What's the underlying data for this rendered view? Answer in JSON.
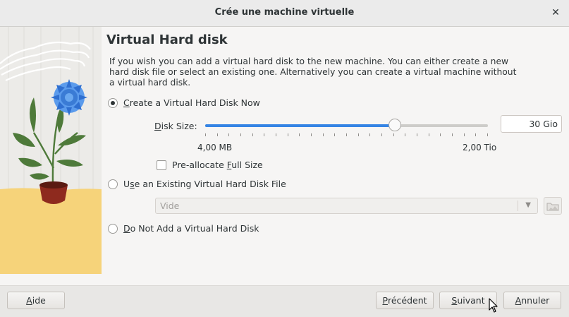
{
  "window": {
    "title": "Crée une machine virtuelle",
    "close_icon": "close-icon"
  },
  "page": {
    "heading": "Virtual Hard disk",
    "description": "If you wish you can add a virtual hard disk to the new machine. You can either create a new hard disk file or select an existing one. Alternatively you can create a virtual machine without a virtual hard disk."
  },
  "options": {
    "create_now": {
      "mnemonic": "C",
      "rest": "reate a Virtual Hard Disk Now",
      "selected": true
    },
    "use_existing": {
      "prefix": "U",
      "mnemonic": "s",
      "rest": "e an Existing Virtual Hard Disk File",
      "selected": false
    },
    "do_not_add": {
      "mnemonic": "D",
      "rest": "o Not Add a Virtual Hard Disk",
      "selected": false
    }
  },
  "disk_size": {
    "label_mnemonic": "D",
    "label_rest": "isk Size:",
    "value": "30 Gio",
    "min_label": "4,00 MB",
    "max_label": "2,00 Tio",
    "slider_fraction": 0.67,
    "tick_count": 25
  },
  "preallocate": {
    "label_pre": "Pre-allocate ",
    "mnemonic": "F",
    "label_rest": "ull Size",
    "checked": false
  },
  "existing_file": {
    "selected": "Vide"
  },
  "buttons": {
    "help": {
      "mnemonic": "A",
      "rest": "ide"
    },
    "previous": {
      "mnemonic": "P",
      "rest": "récédent"
    },
    "next": {
      "mnemonic": "S",
      "rest": "uivant"
    },
    "cancel": {
      "mnemonic": "A",
      "rest": "nnuler"
    }
  },
  "colors": {
    "accent": "#3584e4",
    "illustration_sand": "#f6d37a",
    "flower_blue": "#3a7bd5",
    "pot": "#8e2a1e",
    "leaves": "#4e7a3a"
  }
}
